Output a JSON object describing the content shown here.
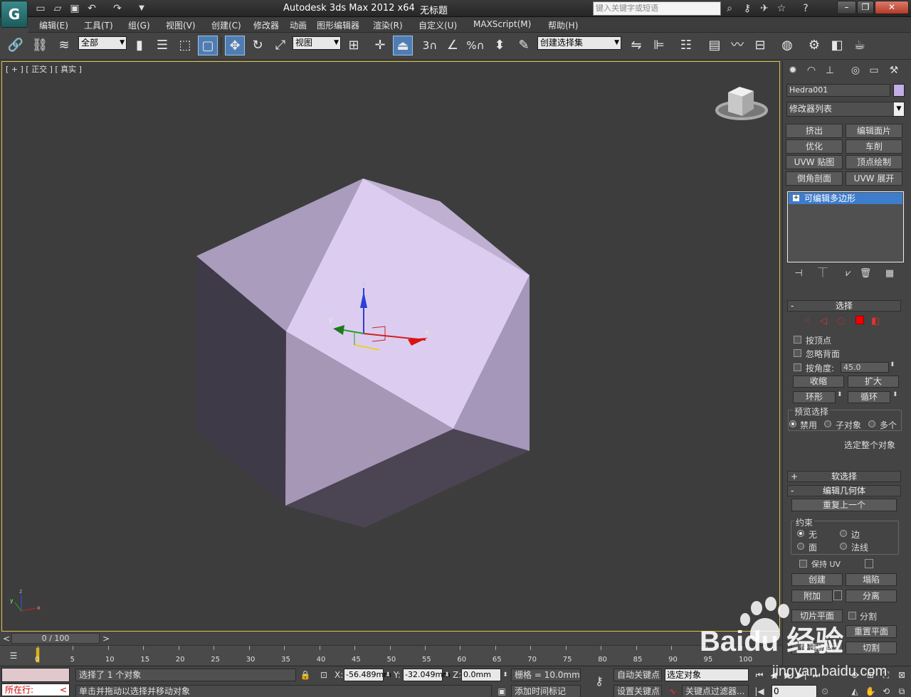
{
  "app": {
    "title": "Autodesk 3ds Max  2012 x64",
    "document": "无标题",
    "logo": "G",
    "search_placeholder": "键入关键字或短语"
  },
  "menu": [
    "编辑(E)",
    "工具(T)",
    "组(G)",
    "视图(V)",
    "创建(C)",
    "修改器",
    "动画",
    "图形编辑器",
    "渲染(R)",
    "自定义(U)",
    "MAXScript(M)",
    "帮助(H)"
  ],
  "toolbar": {
    "filter_value": "全部",
    "refcoord_value": "视图",
    "selection_set_value": "创建选择集",
    "snap_label": "3",
    "angle_snap_label": "%"
  },
  "viewport": {
    "label": "[ + ] [ 正交 ] [ 真实 ]",
    "axis_labels": {
      "x": "x",
      "y": "y",
      "z": "z"
    },
    "object_color": "#c4aee6"
  },
  "command_panel": {
    "object_name": "Hedra001",
    "object_color": "#c4aee6",
    "modifier_list": "修改器列表",
    "modifier_buttons": [
      "挤出",
      "编辑面片",
      "优化",
      "车削",
      "UVW 贴图",
      "顶点绘制",
      "倒角剖面",
      "UVW 展开"
    ],
    "stack_item": "可编辑多边形",
    "selection": {
      "title": "选择",
      "by_vertex": "按顶点",
      "ignore_backface": "忽略背面",
      "by_angle": "按角度:",
      "angle_value": "45.0",
      "shrink": "收缩",
      "grow": "扩大",
      "ring": "环形",
      "loop": "循环",
      "preview_title": "预览选择",
      "preview_off": "禁用",
      "preview_sub": "子对象",
      "preview_multi": "多个",
      "whole_object": "选定整个对象"
    },
    "soft_selection": "软选择",
    "edit_geometry": {
      "title": "编辑几何体",
      "repeat_last": "重复上一个",
      "constraints_title": "约束",
      "c_none": "无",
      "c_edge": "边",
      "c_face": "面",
      "c_normal": "法线",
      "preserve_uv": "保持 UV",
      "create": "创建",
      "collapse": "塌陷",
      "attach": "附加",
      "detach": "分离",
      "slice_plane": "切片平面",
      "split": "分割",
      "reset_plane": "重置平面",
      "quickslice": "快速切片",
      "cut": "切割"
    }
  },
  "timeline": {
    "frame_display": "0 / 100",
    "ticks": [
      "0",
      "5",
      "10",
      "15",
      "20",
      "25",
      "30",
      "35",
      "40",
      "45",
      "50",
      "55",
      "60",
      "65",
      "70",
      "75",
      "80",
      "85",
      "90",
      "95",
      "100"
    ]
  },
  "status": {
    "running_label": "所在行:",
    "selected": "选择了 1 个对象",
    "prompt": "单击并拖动以选择并移动对象",
    "x_label": "X:",
    "x_value": "-56.489mm",
    "y_label": "Y:",
    "y_value": "-32.049mm",
    "z_label": "Z:",
    "z_value": "0.0mm",
    "grid": "栅格 = 10.0mm",
    "auto_key": "自动关键点",
    "set_key": "设置关键点",
    "selected_object": "选定对象",
    "key_filters": "关键点过滤器...",
    "add_time_tag": "添加时间标记",
    "frame_value": "0"
  },
  "watermark": {
    "brand": "Baidu 经验",
    "url": "jingyan.baidu.com"
  }
}
